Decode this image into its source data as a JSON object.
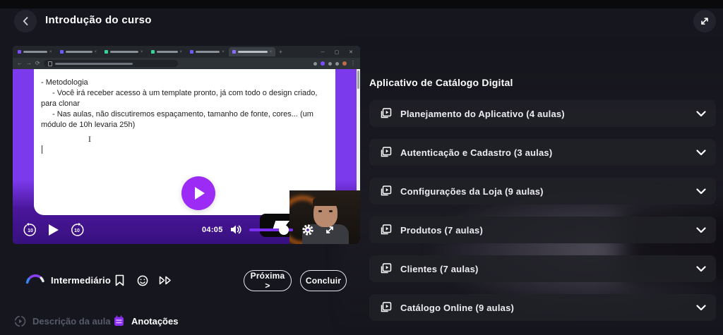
{
  "header": {
    "title": "Introdução do curso"
  },
  "video_doc": {
    "line1": "- Metodologia",
    "line2": "- Você irá receber acesso à um template pronto, já com todo o design criado, para clonar",
    "line3": "- Nas aulas, não discutiremos espaçamento, tamanho de fonte, cores... (um módulo de 10h levaria 25h)"
  },
  "player": {
    "time": "04:05",
    "rewind_seconds": "10",
    "forward_seconds": "10"
  },
  "lesson": {
    "difficulty": "Intermediário",
    "next_button": "Próxima >",
    "complete_button": "Concluir"
  },
  "footer_tabs": {
    "description": "Descrição da aula",
    "notes": "Anotações"
  },
  "playlist": {
    "title": "Aplicativo de Catálogo Digital",
    "modules": [
      {
        "label": "Planejamento do Aplicativo (4 aulas)"
      },
      {
        "label": "Autenticação e Cadastro (3 aulas)"
      },
      {
        "label": "Configurações da Loja (9 aulas)"
      },
      {
        "label": "Produtos (7 aulas)"
      },
      {
        "label": "Clientes (7 aulas)"
      },
      {
        "label": "Catálogo Online (9 aulas)"
      }
    ]
  },
  "colors": {
    "accent_purple": "#9b2bf5",
    "page_purple": "#7c3aed",
    "player_bar_purple": "#4a169b",
    "background": "#16161e"
  }
}
